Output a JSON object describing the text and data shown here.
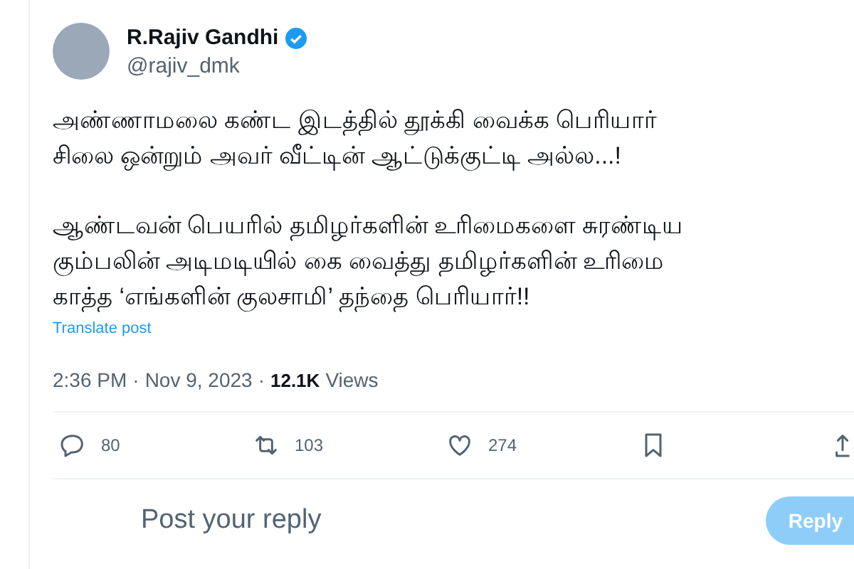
{
  "author": {
    "name": "R.Rajiv Gandhi",
    "verified": true,
    "handle": "@rajiv_dmk"
  },
  "post": {
    "paragraphs": [
      [
        "அண்ணாமலை கண்ட இடத்தில் தூக்கி வைக்க பெரியார்",
        "சிலை ஒன்றும் அவர் வீட்டின் ஆட்டுக்குட்டி அல்ல...!"
      ],
      [
        "ஆண்டவன் பெயரில் தமிழர்களின் உரிமைகளை சுரண்டிய",
        "கும்பலின் அடிமடியில் கை வைத்து தமிழர்களின் உரிமை",
        "காத்த ‘எங்களின் குலசாமி’ தந்தை பெரியார்!!"
      ]
    ],
    "translate": "Translate post"
  },
  "meta": {
    "separator": "·",
    "time": "2:36 PM",
    "date": "Nov 9, 2023",
    "views_count": "12.1K",
    "views_label": "Views"
  },
  "actions": [
    {
      "kind": "reply",
      "count": "80"
    },
    {
      "kind": "repost",
      "count": "103"
    },
    {
      "kind": "like",
      "count": "274"
    },
    {
      "kind": "bookmark"
    },
    {
      "kind": "share"
    }
  ],
  "composer": {
    "placeholder": "Post your reply",
    "button": "Reply",
    "disabled": true
  }
}
